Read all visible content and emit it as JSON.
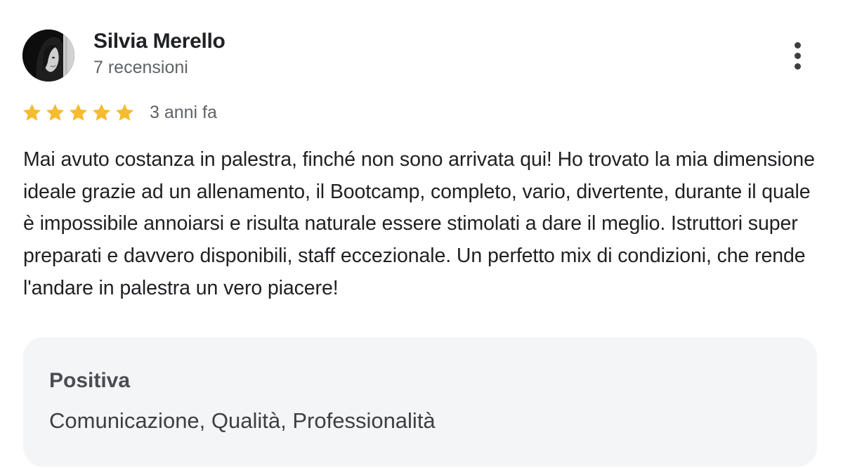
{
  "review": {
    "author_name": "Silvia Merello",
    "review_count": "7 recensioni",
    "rating": 5,
    "rating_max": 5,
    "star_color": "#F6BB2F",
    "date": "3 anni fa",
    "text": "Mai avuto costanza in palestra, finché non sono arrivata qui! Ho trovato la mia dimensione ideale grazie ad un allenamento, il Bootcamp, completo, vario, divertente, durante il quale è impossibile annoiarsi e risulta naturale essere stimolati a dare il meglio. Istruttori super preparati e davvero disponibili, staff eccezionale. Un perfetto mix di condizioni, che rende l'andare in palestra un vero piacere!",
    "attributes": {
      "title": "Positiva",
      "values": "Comunicazione, Qualità, Professionalità"
    },
    "avatar_icon": "profile-photo",
    "menu_icon": "more-vert-icon"
  }
}
